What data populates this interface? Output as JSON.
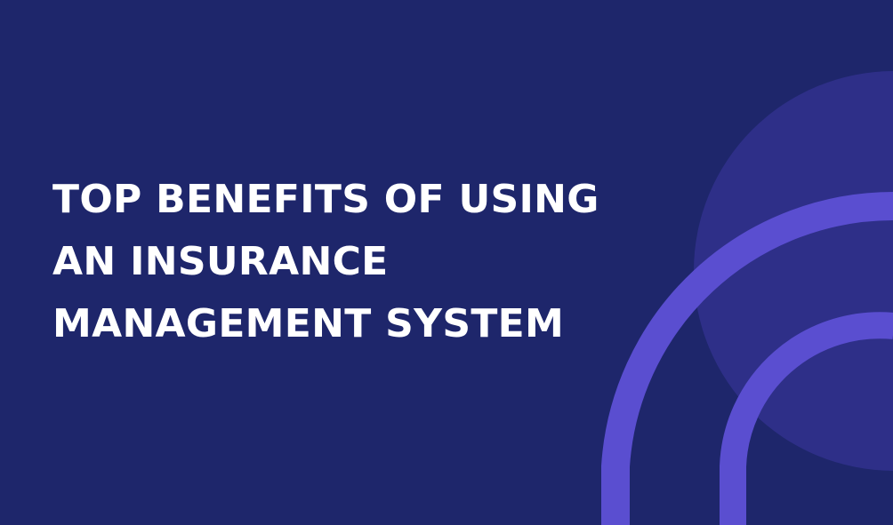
{
  "headline": {
    "line1": "TOP BENEFITS OF USING",
    "line2": "AN INSURANCE",
    "line3": "MANAGEMENT SYSTEM"
  },
  "colors": {
    "background": "#1e266b",
    "circle": "#2e2f88",
    "arc": "#5a4ed0",
    "text": "#ffffff"
  }
}
